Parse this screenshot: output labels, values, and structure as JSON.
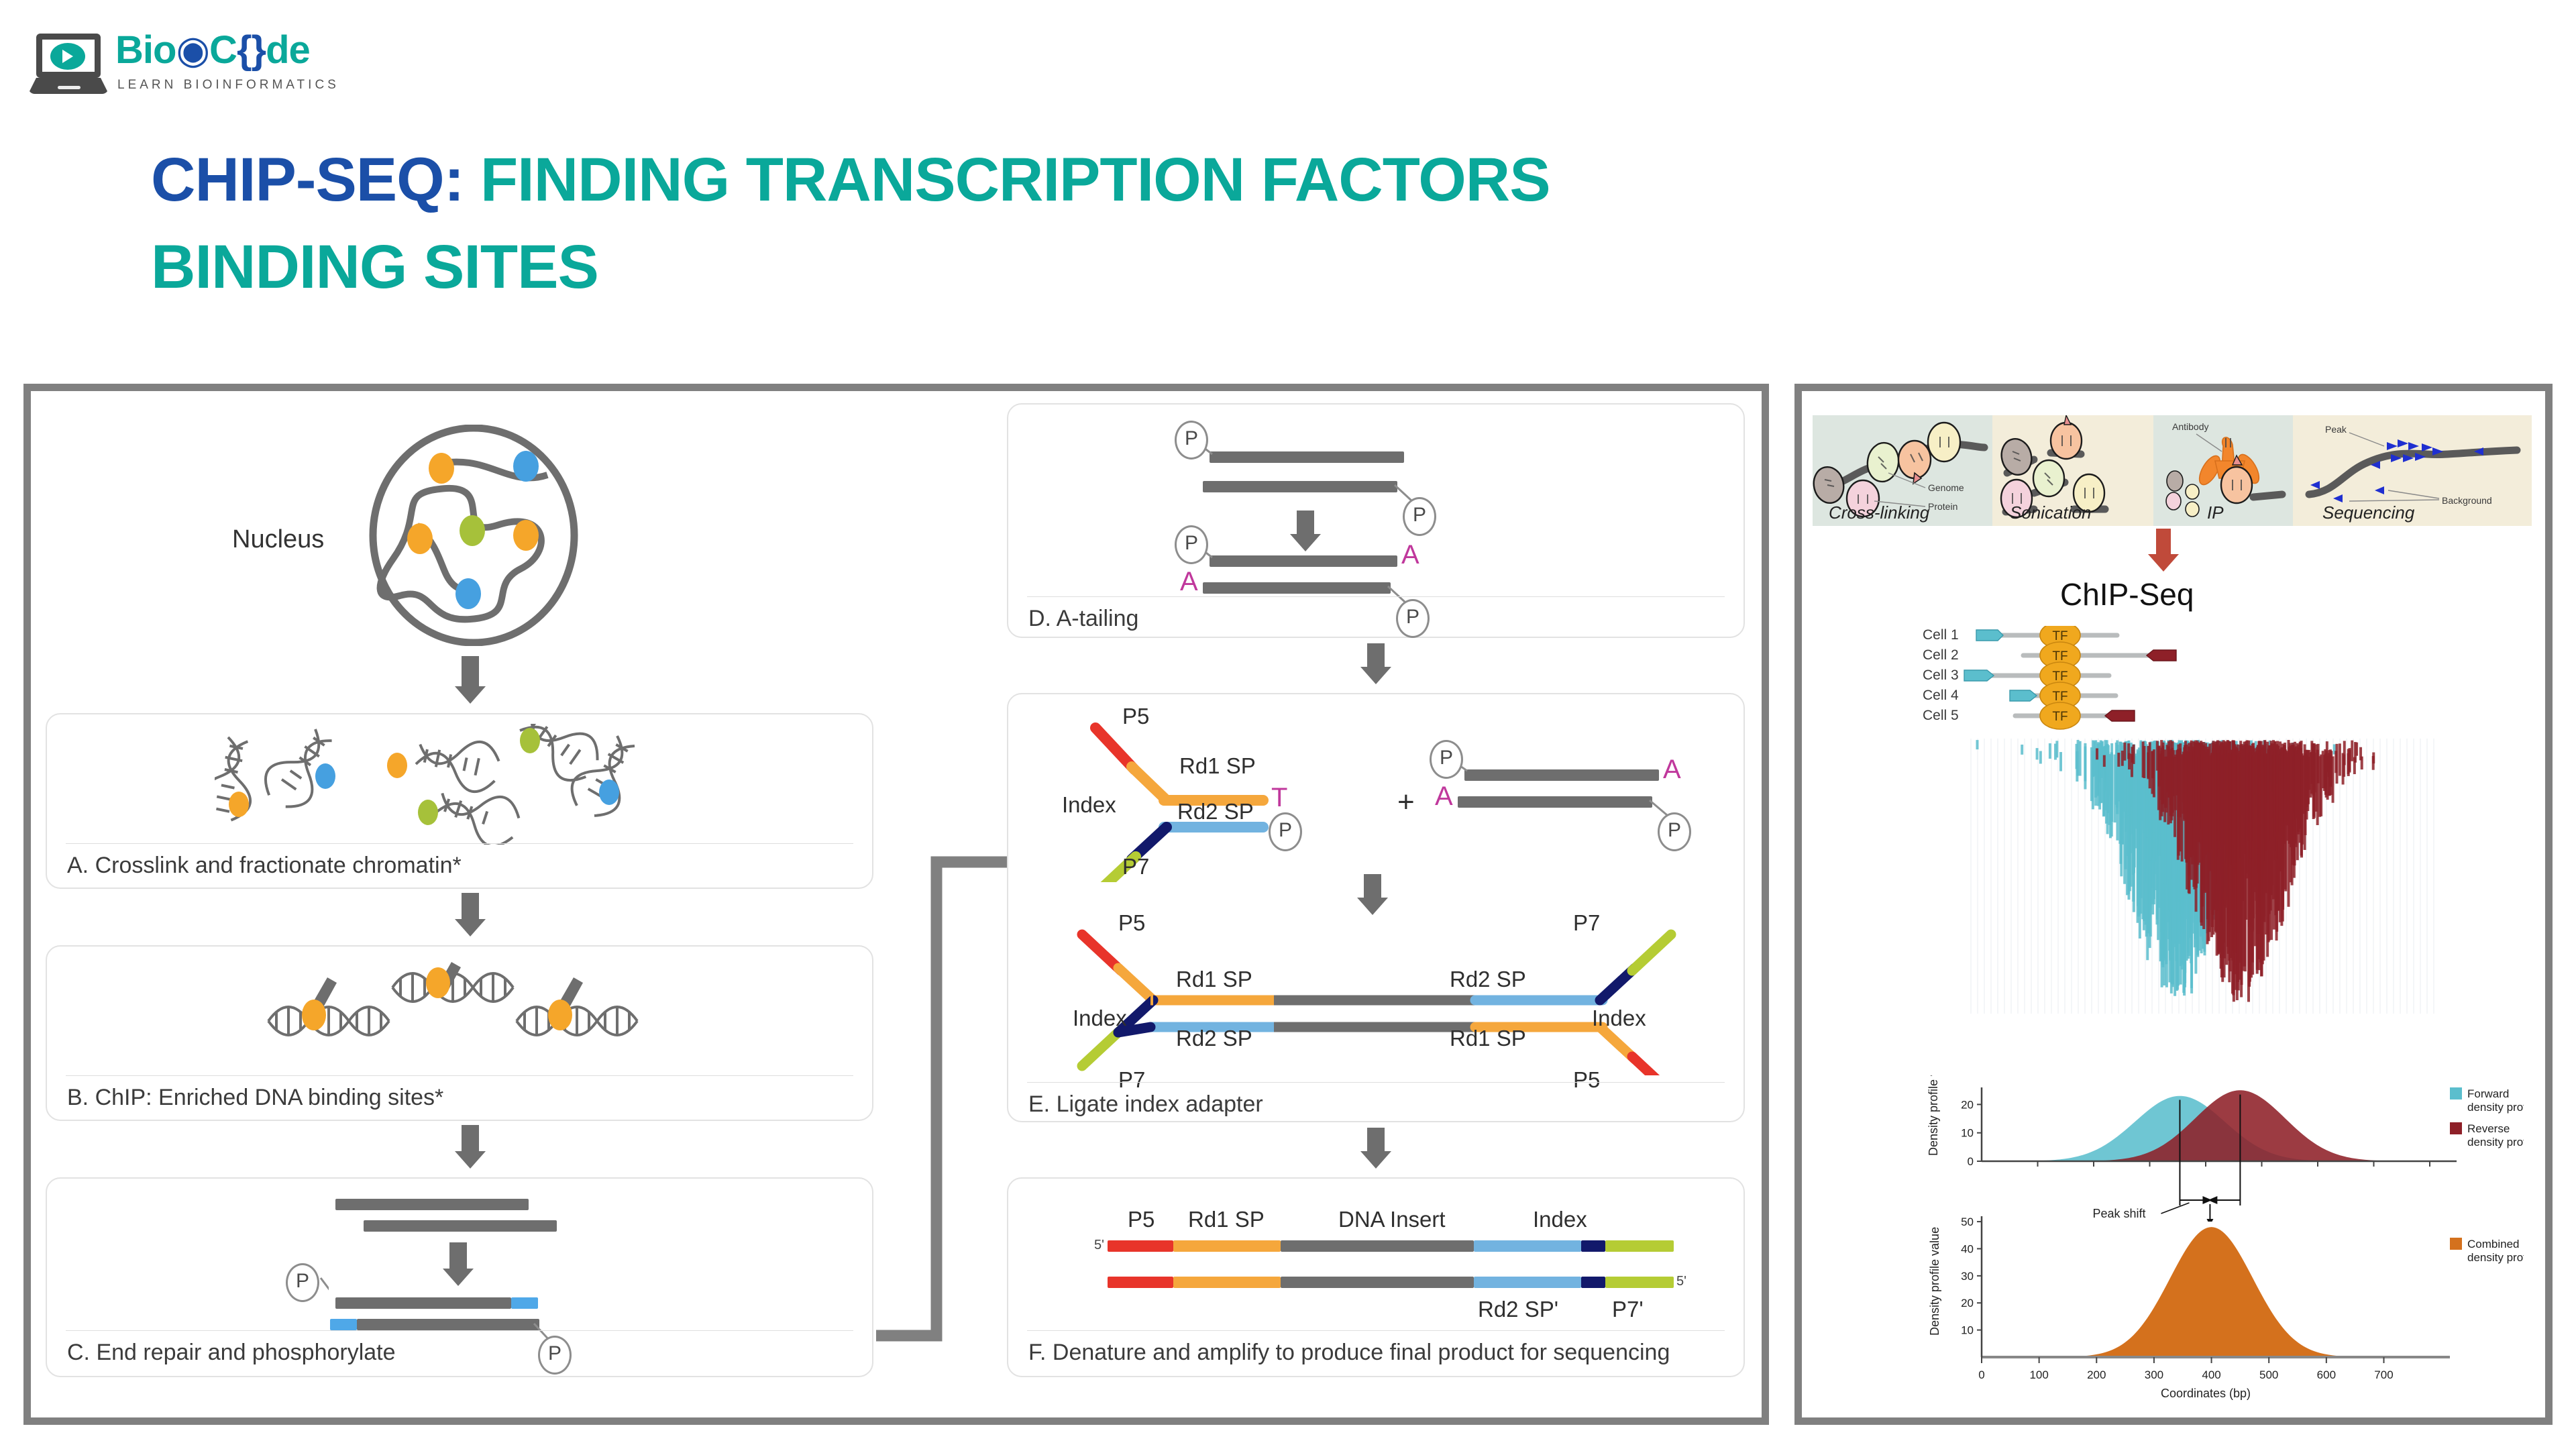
{
  "logo": {
    "name_part1": "Bio",
    "name_part2": "C",
    "name_part3": "de",
    "full_name": "BioCode",
    "tagline": "LEARN BIOINFORMATICS",
    "colors": {
      "teal": "#0aa89a",
      "blue": "#1b4fa8",
      "dark": "#4a4a4a"
    }
  },
  "title": {
    "prefix": "CHIP-SEQ:",
    "main": "FINDING TRANSCRIPTION FACTORS",
    "line2": "BINDING SITES",
    "prefix_color": "#1b4fa8",
    "main_color": "#0aa89a"
  },
  "left_panel": {
    "nucleus_label": "Nucleus",
    "steps": [
      {
        "id": "A",
        "caption": "A. Crosslink and fractionate chromatin*"
      },
      {
        "id": "B",
        "caption": "B. ChIP: Enriched DNA binding sites*"
      },
      {
        "id": "C",
        "caption": "C. End repair and phosphorylate"
      }
    ]
  },
  "middle_panel": {
    "steps": [
      {
        "id": "D",
        "caption": "D. A-tailing"
      },
      {
        "id": "E",
        "caption": "E. Ligate index adapter"
      },
      {
        "id": "F",
        "caption": "F. Denature and amplify to produce final product for sequencing"
      }
    ],
    "phosphate_symbol": "P",
    "adenine_symbol": "A",
    "thymine_symbol": "T",
    "plus_symbol": "+",
    "adapter_labels": {
      "p5": "P5",
      "p7": "P7",
      "rd1": "Rd1 SP",
      "rd2": "Rd2 SP",
      "index": "Index"
    },
    "final_product": {
      "five_prime": "5'",
      "segments": [
        "P5",
        "Rd1 SP",
        "DNA Insert",
        "Index"
      ],
      "bottom_segments": [
        "Rd2 SP'",
        "P7'"
      ]
    },
    "colors": {
      "p5": "#e8342a",
      "rd1": "#f5a73c",
      "insert": "#6e6e6e",
      "rd2": "#72b3e0",
      "index": "#12196b",
      "p7": "#b5cc34",
      "adenine": "#c0389c"
    }
  },
  "right_panel": {
    "top_strip": {
      "panels": [
        {
          "label": "Cross-linking",
          "bg": "#dde6e0"
        },
        {
          "label": "Sonication",
          "bg": "#f3edda"
        },
        {
          "label": "IP",
          "bg": "#dde6e0"
        },
        {
          "label": "Sequencing",
          "bg": "#f3edda"
        }
      ],
      "annotations": [
        "Genome",
        "Protein",
        "Antibody",
        "Peak",
        "Background"
      ]
    },
    "chipseq_title": "ChIP-Seq",
    "cells": [
      "Cell 1",
      "Cell 2",
      "Cell 3",
      "Cell 4",
      "Cell 5"
    ],
    "tf_label": "TF",
    "peak_shift_label": "Peak shift",
    "colors": {
      "forward": "#5bbecd",
      "reverse": "#8e2028",
      "combined": "#d4711d",
      "tf": "#f0a81e"
    }
  },
  "chart_data": [
    {
      "type": "area",
      "title": "",
      "xlabel": "",
      "ylabel": "Density profile value",
      "yticks": [
        0,
        10,
        20
      ],
      "ylim": [
        0,
        26
      ],
      "xlim": [
        0,
        780
      ],
      "grid": false,
      "legend_position": "right",
      "series": [
        {
          "name": "Forward density profile",
          "color": "#5bbecd",
          "peak_x": 345,
          "peak_y": 23,
          "sigma": 78
        },
        {
          "name": "Reverse density profile",
          "color": "#8e2028",
          "peak_x": 450,
          "peak_y": 25,
          "sigma": 78
        }
      ],
      "annotations": [
        {
          "text": "Peak shift",
          "from_x": 345,
          "to_x": 450
        }
      ]
    },
    {
      "type": "area",
      "title": "",
      "xlabel": "Coordinates (bp)",
      "ylabel": "Density profile value",
      "yticks": [
        0,
        10,
        20,
        30,
        40,
        50
      ],
      "ylim": [
        0,
        52
      ],
      "xticks": [
        0,
        100,
        200,
        300,
        400,
        500,
        600,
        700
      ],
      "xlim": [
        0,
        780
      ],
      "grid": false,
      "legend_position": "right",
      "series": [
        {
          "name": "Combined density profile",
          "color": "#d4711d",
          "peak_x": 400,
          "peak_y": 48,
          "sigma": 72
        }
      ]
    }
  ]
}
